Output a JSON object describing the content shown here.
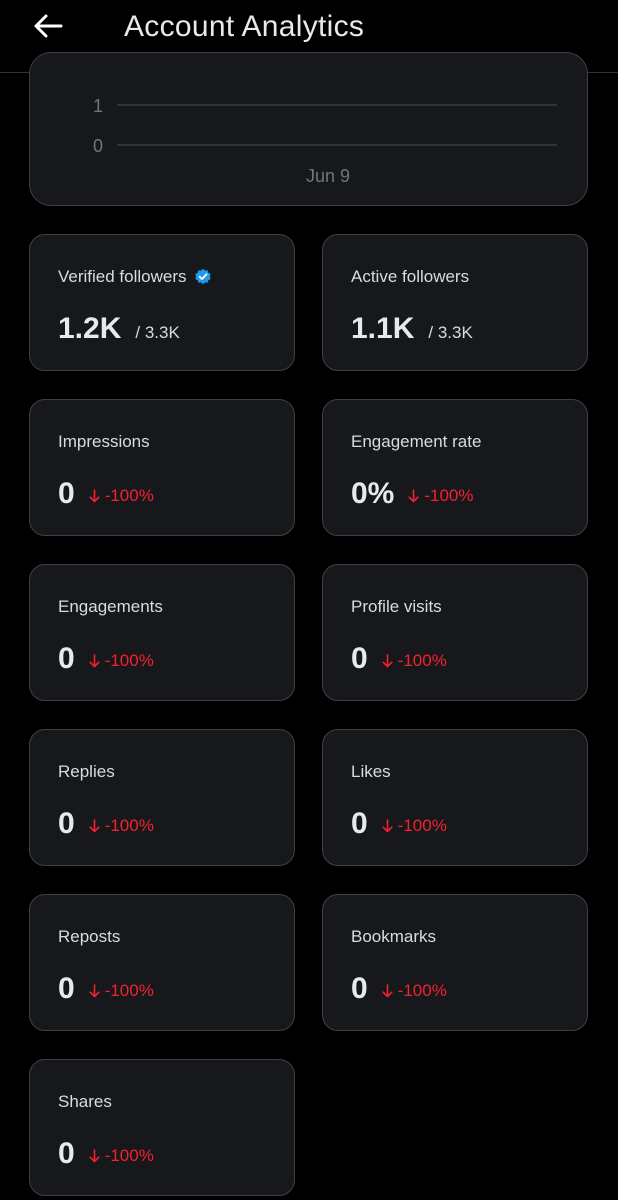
{
  "header": {
    "title": "Account Analytics"
  },
  "chart_data": {
    "type": "line",
    "x": [
      "Jun 9"
    ],
    "y_ticks": [
      "1",
      "0"
    ],
    "series": []
  },
  "cards": [
    {
      "label": "Verified followers",
      "value": "1.2K",
      "total": "/ 3.3K",
      "verified": true
    },
    {
      "label": "Active followers",
      "value": "1.1K",
      "total": "/ 3.3K"
    },
    {
      "label": "Impressions",
      "value": "0",
      "change": "-100%"
    },
    {
      "label": "Engagement rate",
      "value": "0%",
      "change": "-100%"
    },
    {
      "label": "Engagements",
      "value": "0",
      "change": "-100%"
    },
    {
      "label": "Profile visits",
      "value": "0",
      "change": "-100%"
    },
    {
      "label": "Replies",
      "value": "0",
      "change": "-100%"
    },
    {
      "label": "Likes",
      "value": "0",
      "change": "-100%"
    },
    {
      "label": "Reposts",
      "value": "0",
      "change": "-100%"
    },
    {
      "label": "Bookmarks",
      "value": "0",
      "change": "-100%"
    },
    {
      "label": "Shares",
      "value": "0",
      "change": "-100%"
    }
  ],
  "colors": {
    "background": "#000000",
    "card": "#16181c",
    "card_border": "#3e4144",
    "negative": "#f4212e",
    "verified": "#1d9bf0"
  }
}
